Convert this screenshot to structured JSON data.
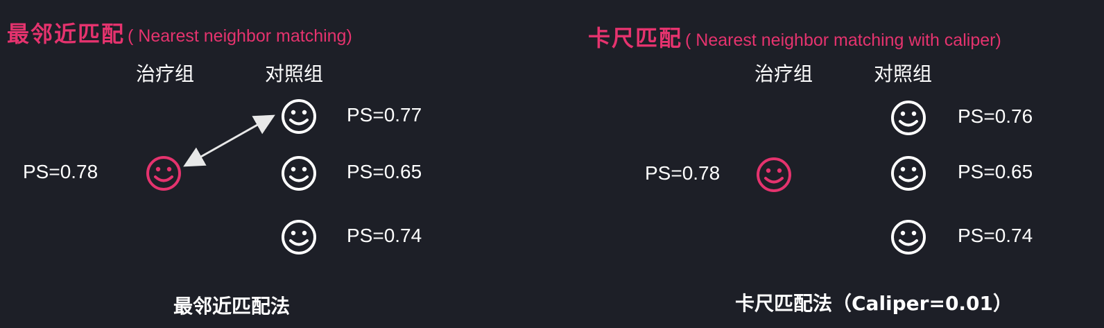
{
  "left": {
    "title_cn": "最邻近匹配",
    "title_en": "( Nearest neighbor matching)",
    "treatment_label": "治疗组",
    "control_label": "对照组",
    "treatment_ps": "PS=0.78",
    "control_ps": [
      "PS=0.77",
      "PS=0.65",
      "PS=0.74"
    ],
    "caption": "最邻近匹配法"
  },
  "right": {
    "title_cn": "卡尺匹配",
    "title_en": "( Nearest neighbor matching with caliper)",
    "treatment_label": "治疗组",
    "control_label": "对照组",
    "treatment_ps": "PS=0.78",
    "control_ps": [
      "PS=0.76",
      "PS=0.65",
      "PS=0.74"
    ],
    "caption": "卡尺匹配法（Caliper=0.01）"
  },
  "colors": {
    "background": "#1d1f27",
    "accent": "#e5336e",
    "text": "#ffffff"
  },
  "icons": {
    "treatment": "smiley-face-icon",
    "control": "smiley-face-icon",
    "match": "double-headed-arrow-icon"
  }
}
